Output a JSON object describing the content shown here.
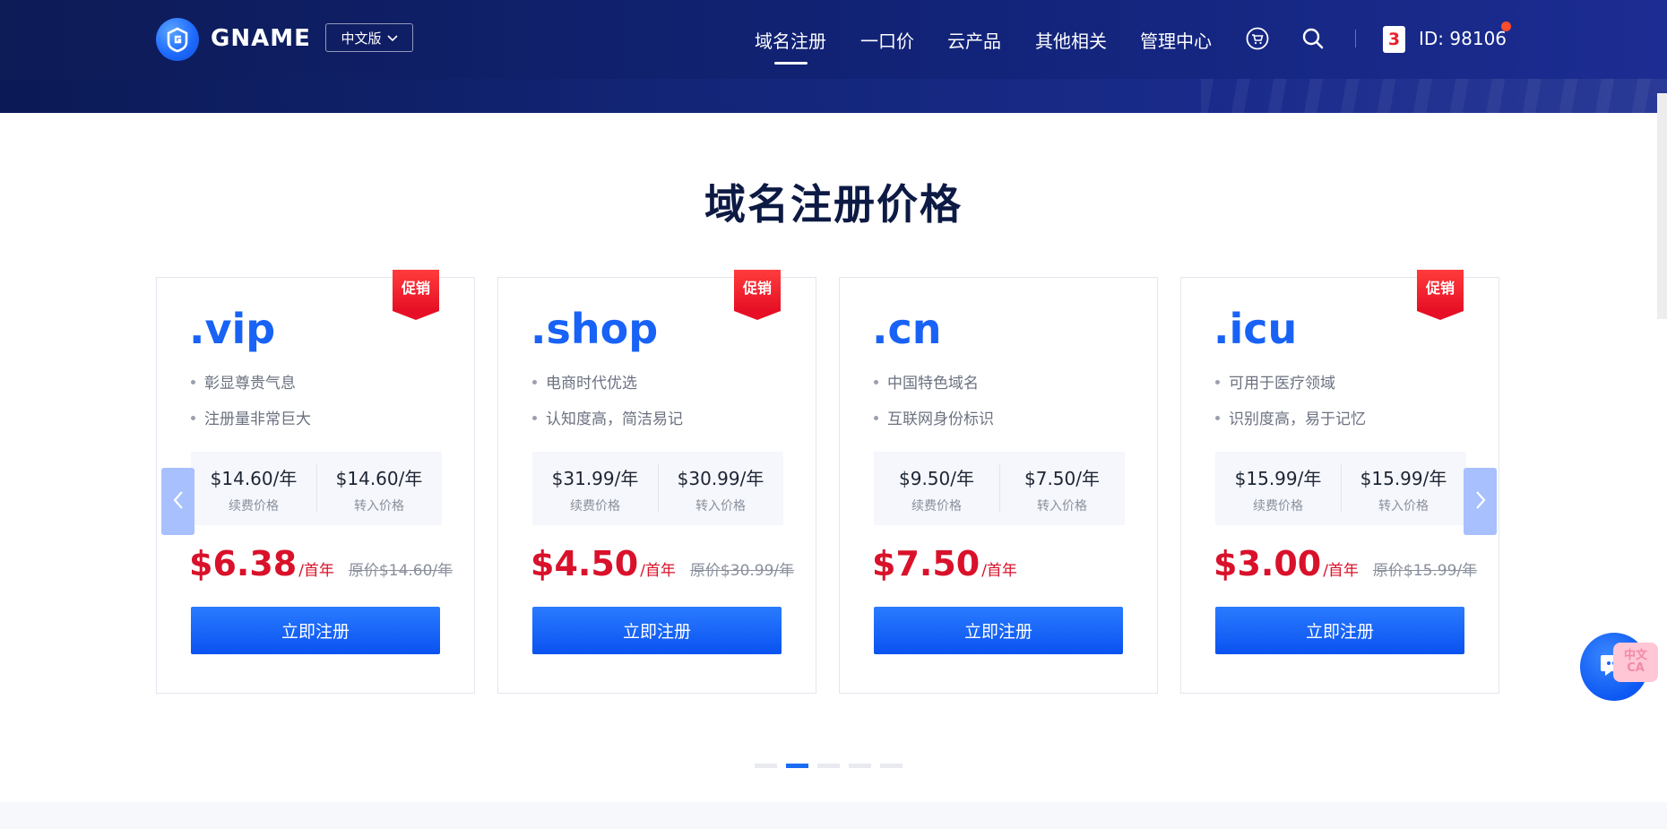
{
  "header": {
    "logo_text": "GNAME",
    "language": "中文版",
    "nav": [
      "域名注册",
      "一口价",
      "云产品",
      "其他相关",
      "管理中心"
    ],
    "user_badge": "3",
    "user_id": "ID: 98106"
  },
  "section": {
    "title": "域名注册价格"
  },
  "cards": [
    {
      "tld": ".vip",
      "promo": "促销",
      "features": [
        "彰显尊贵气息",
        "注册量非常巨大"
      ],
      "renew_price": "$14.60/年",
      "renew_label": "续费价格",
      "transfer_price": "$14.60/年",
      "transfer_label": "转入价格",
      "sale_price": "$6.38",
      "sale_unit": "/首年",
      "original": "原价$14.60/年",
      "button": "立即注册"
    },
    {
      "tld": ".shop",
      "promo": "促销",
      "features": [
        "电商时代优选",
        "认知度高，简洁易记"
      ],
      "renew_price": "$31.99/年",
      "renew_label": "续费价格",
      "transfer_price": "$30.99/年",
      "transfer_label": "转入价格",
      "sale_price": "$4.50",
      "sale_unit": "/首年",
      "original": "原价$30.99/年",
      "button": "立即注册"
    },
    {
      "tld": ".cn",
      "promo": "",
      "features": [
        "中国特色域名",
        "互联网身份标识"
      ],
      "renew_price": "$9.50/年",
      "renew_label": "续费价格",
      "transfer_price": "$7.50/年",
      "transfer_label": "转入价格",
      "sale_price": "$7.50",
      "sale_unit": "/首年",
      "original": "",
      "button": "立即注册"
    },
    {
      "tld": ".icu",
      "promo": "促销",
      "features": [
        "可用于医疗领域",
        "识别度高，易于记忆"
      ],
      "renew_price": "$15.99/年",
      "renew_label": "续费价格",
      "transfer_price": "$15.99/年",
      "transfer_label": "转入价格",
      "sale_price": "$3.00",
      "sale_unit": "/首年",
      "original": "原价$15.99/年",
      "button": "立即注册"
    }
  ],
  "carousel": {
    "total": 5,
    "active": 2
  },
  "chat": {
    "tag": "中文 CA"
  },
  "colors": {
    "accent": "#1862f6",
    "sale": "#d9112a",
    "nav_bg": "#12247a"
  }
}
